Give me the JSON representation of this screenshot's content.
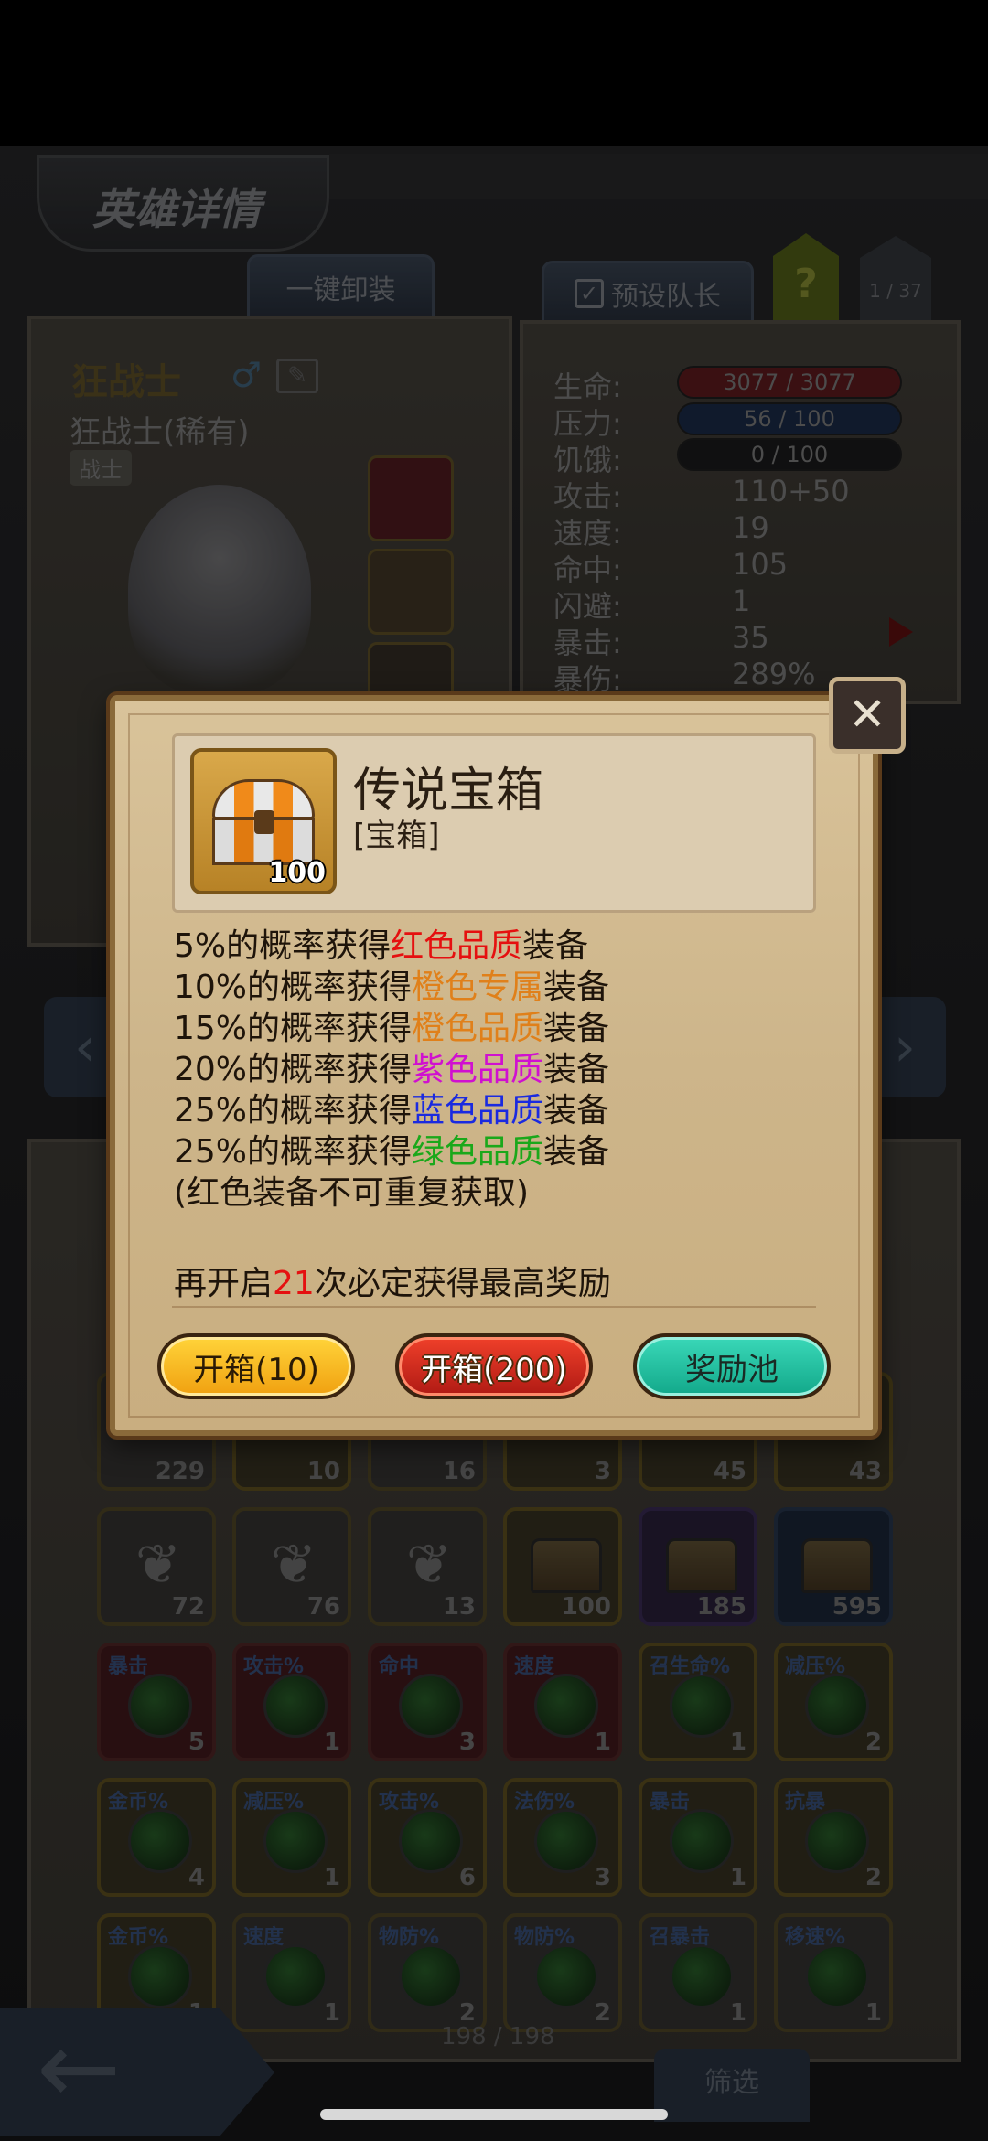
{
  "header": {
    "title": "英雄详情",
    "unequip_all": "一键卸装",
    "preset_captain": "预设队长",
    "help": "?",
    "page": "1 / 37"
  },
  "hero": {
    "name": "狂战士",
    "class_rarity": "狂战士(稀有)",
    "tag": "战士"
  },
  "stats": {
    "hp_label": "生命:",
    "hp": "3077 / 3077",
    "stress_label": "压力:",
    "stress": "56 / 100",
    "hunger_label": "饥饿:",
    "hunger": "0 / 100",
    "attack_label": "攻击:",
    "attack": "110+50",
    "speed_label": "速度:",
    "speed": "19",
    "accuracy_label": "命中:",
    "accuracy": "105",
    "dodge_label": "闪避:",
    "dodge": "1",
    "crit_label": "暴击:",
    "crit": "35",
    "crit_dmg_label": "暴伤:",
    "crit_dmg": "289%"
  },
  "inventory": {
    "row1": [
      "229",
      "10",
      "16",
      "3",
      "45",
      "43"
    ],
    "row2": [
      "72",
      "76",
      "13",
      "100",
      "185",
      "595"
    ],
    "row3": [
      {
        "label": "暴击",
        "qty": "5"
      },
      {
        "label": "攻击%",
        "qty": "1"
      },
      {
        "label": "命中",
        "qty": "3"
      },
      {
        "label": "速度",
        "qty": "1"
      },
      {
        "label": "召生命%",
        "qty": "1"
      },
      {
        "label": "减压%",
        "qty": "2"
      }
    ],
    "row4": [
      {
        "label": "金币%",
        "qty": "4"
      },
      {
        "label": "减压%",
        "qty": "1"
      },
      {
        "label": "攻击%",
        "qty": "6"
      },
      {
        "label": "法伤%",
        "qty": "3"
      },
      {
        "label": "暴击",
        "qty": "1"
      },
      {
        "label": "抗暴",
        "qty": "2"
      }
    ],
    "row5": [
      {
        "label": "金币%",
        "qty": "1"
      },
      {
        "label": "速度",
        "qty": "1"
      },
      {
        "label": "物防%",
        "qty": "2"
      },
      {
        "label": "物防%",
        "qty": "2"
      },
      {
        "label": "召暴击",
        "qty": "1"
      },
      {
        "label": "移速%",
        "qty": "1"
      }
    ],
    "count": "198 / 198",
    "filter": "筛选"
  },
  "modal": {
    "item_name": "传说宝箱",
    "item_type": "[宝箱]",
    "item_qty": "100",
    "odds": [
      {
        "pre": "5%的概率获得",
        "hl": "红色品质",
        "post": "装备"
      },
      {
        "pre": "10%的概率获得",
        "hl": "橙色专属",
        "post": "装备"
      },
      {
        "pre": "15%的概率获得",
        "hl": "橙色品质",
        "post": "装备"
      },
      {
        "pre": "20%的概率获得",
        "hl": "紫色品质",
        "post": "装备"
      },
      {
        "pre": "25%的概率获得",
        "hl": "蓝色品质",
        "post": "装备"
      },
      {
        "pre": "25%的概率获得",
        "hl": "绿色品质",
        "post": "装备"
      }
    ],
    "note": "(红色装备不可重复获取)",
    "pity_pre": "再开启",
    "pity_num": "21",
    "pity_post": "次必定获得最高奖励",
    "btn_open10": "开箱(10)",
    "btn_open200": "开箱(200)",
    "btn_pool": "奖励池"
  }
}
